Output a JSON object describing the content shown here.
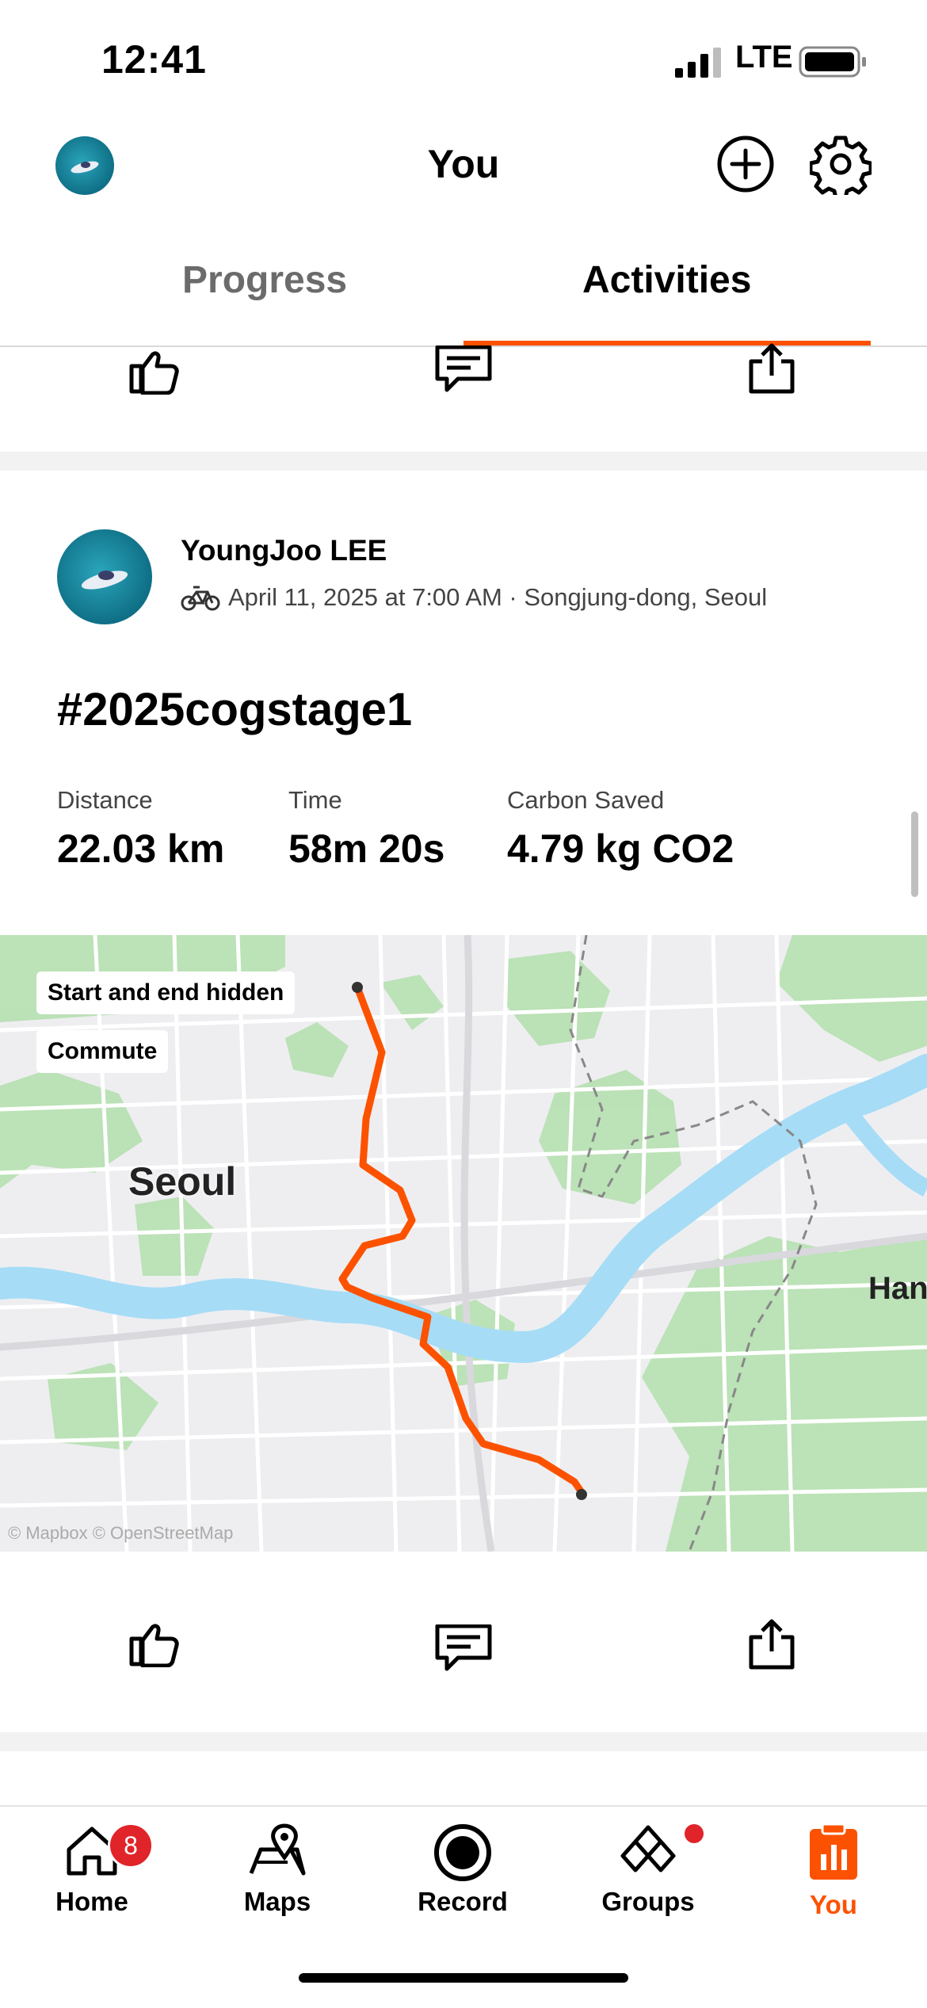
{
  "status_bar": {
    "time": "12:41",
    "network": "LTE"
  },
  "header": {
    "title": "You",
    "add_icon": "plus-circle-icon",
    "settings_icon": "gear-icon"
  },
  "tabs": [
    {
      "label": "Progress",
      "active": false
    },
    {
      "label": "Activities",
      "active": true
    }
  ],
  "colors": {
    "accent": "#fc5200",
    "route": "#fc5200",
    "water": "#a6dcf6",
    "park": "#b6e0b0"
  },
  "activity": {
    "athlete": "YoungJoo LEE",
    "sport_icon": "bike-icon",
    "meta": "April 11, 2025 at 7:00 AM · Songjung-dong, Seoul",
    "title": "#2025cogstage1",
    "stats": [
      {
        "label": "Distance",
        "value": "22.03 km"
      },
      {
        "label": "Time",
        "value": "58m 20s"
      },
      {
        "label": "Carbon Saved",
        "value": "4.79 kg CO2"
      }
    ],
    "map": {
      "badges": [
        "Start and end hidden",
        "Commute"
      ],
      "place_labels": [
        "Seoul",
        "Han"
      ],
      "attribution": "© Mapbox © OpenStreetMap"
    }
  },
  "actions": {
    "like_icon": "thumbs-up-icon",
    "comment_icon": "comment-icon",
    "share_icon": "share-icon"
  },
  "bottom_nav": [
    {
      "label": "Home",
      "icon": "home-icon",
      "badge": "8",
      "active": false
    },
    {
      "label": "Maps",
      "icon": "map-icon",
      "active": false
    },
    {
      "label": "Record",
      "icon": "record-icon",
      "active": false
    },
    {
      "label": "Groups",
      "icon": "groups-icon",
      "dot": true,
      "active": false
    },
    {
      "label": "You",
      "icon": "you-icon",
      "active": true
    }
  ]
}
